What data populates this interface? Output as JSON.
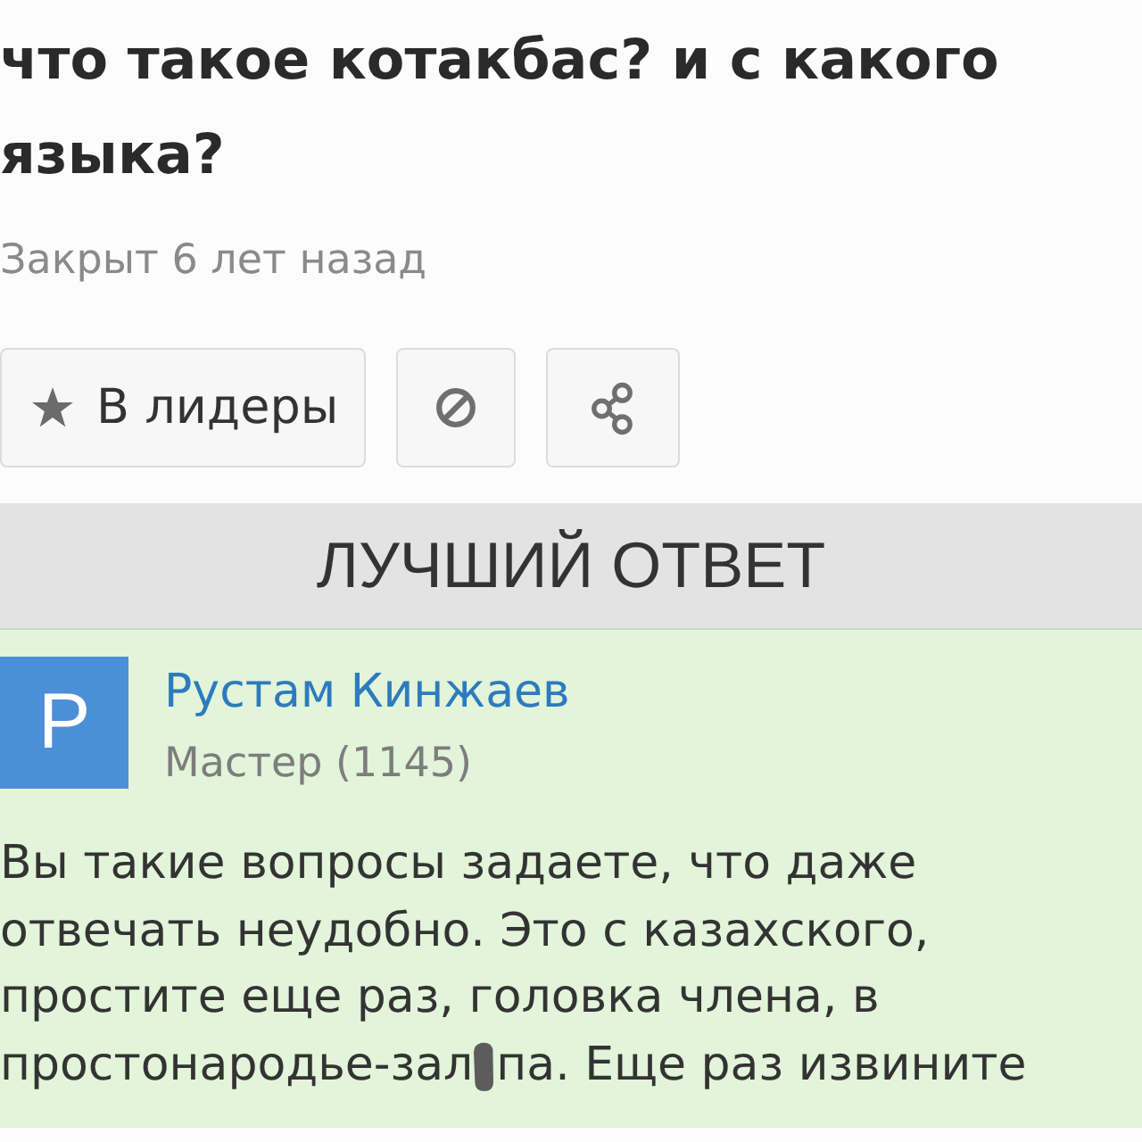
{
  "question": {
    "title": "что такое котакбас? и с какого языка?",
    "status": "Закрыт 6 лет назад"
  },
  "actions": [
    {
      "kind": "leaders",
      "label": "В лидеры"
    },
    {
      "kind": "report"
    },
    {
      "kind": "share"
    }
  ],
  "best_answer": {
    "heading": "ЛУЧШИЙ ОТВЕТ",
    "author": {
      "initial": "Р",
      "name": "Рустам Кинжаев",
      "rank": "Мастер (1145)"
    },
    "text": "Вы такие вопросы задаете, что даже отвечать неудобно. Это с казахского, простите еще раз, головка члена, в",
    "last_line": {
      "before": "простонародье-зал",
      "censored": true,
      "after": "па. Еще раз извините"
    }
  }
}
